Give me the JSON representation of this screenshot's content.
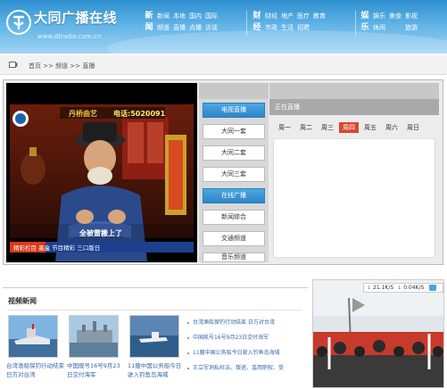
{
  "header": {
    "logo_name": "大同广播在线",
    "logo_url": "www.dtradio.com.cn",
    "groups": [
      {
        "head": [
          "新",
          "闻"
        ],
        "cols": [
          [
            "新闻",
            "频道"
          ],
          [
            "本地",
            "直播"
          ],
          [
            "国内",
            "点播"
          ],
          [
            "国际",
            "访谈"
          ]
        ]
      },
      {
        "head": [
          "财",
          "经"
        ],
        "cols": [
          [
            "财经",
            "市政"
          ],
          [
            "地产",
            "生活"
          ],
          [
            "医疗",
            "招聘"
          ],
          [
            "教育",
            ""
          ]
        ]
      },
      {
        "head": [
          "娱",
          "乐"
        ],
        "cols": [
          [
            "娱乐",
            "休闲"
          ],
          [
            "",
            "美食"
          ],
          [
            "影视",
            "旅游"
          ]
        ]
      }
    ]
  },
  "breadcrumb": "首页 >> 频道 >> 直播",
  "video": {
    "channel_logo": "丹桥曲艺",
    "phone": "电话:5020091",
    "subtitle": "全被雷搬上了",
    "ticker": "精彩栏目  墨盒  节目精彩  三口版日"
  },
  "channels": [
    {
      "label": "电视直播",
      "active": true
    },
    {
      "label": "大同一套",
      "active": false
    },
    {
      "label": "大同二套",
      "active": false
    },
    {
      "label": "大同三套",
      "active": false
    },
    {
      "label": "在线广播",
      "active": true
    },
    {
      "label": "新闻综合",
      "active": false
    },
    {
      "label": "交通频道",
      "active": false
    },
    {
      "label": "音乐频道",
      "active": false
    }
  ],
  "schedule": {
    "title": "正在直播",
    "days": [
      {
        "label": "周一",
        "active": false
      },
      {
        "label": "周二",
        "active": false
      },
      {
        "label": "周三",
        "active": false
      },
      {
        "label": "周四",
        "active": true
      },
      {
        "label": "周五",
        "active": false
      },
      {
        "label": "周六",
        "active": false
      },
      {
        "label": "周日",
        "active": false
      }
    ]
  },
  "news": {
    "title": "视频新闻",
    "items": [
      {
        "caption": "台湾渔船保钓行动结束 日方对台湾"
      },
      {
        "caption": "中国舰号16号9月23日交付海军"
      },
      {
        "caption": "11艘中国公务船今日驶入钓鱼岛海域"
      }
    ],
    "list": [
      "台湾渔船保钓行动结束 日方对台湾",
      "中国航号16号9月23日交付海军",
      "11艘中国公务船今日驶入钓鱼岛海域",
      "王立军询私枉法、叛逃、滥用职权、受"
    ]
  },
  "right_box": {
    "upload_speed": "21.1K/S",
    "download_speed": "0.04K/S"
  },
  "colors": {
    "header_blue": "#2d8fcf",
    "active_channel": "#2c86c8",
    "active_day": "#d9482b",
    "link_blue": "#3366aa"
  }
}
